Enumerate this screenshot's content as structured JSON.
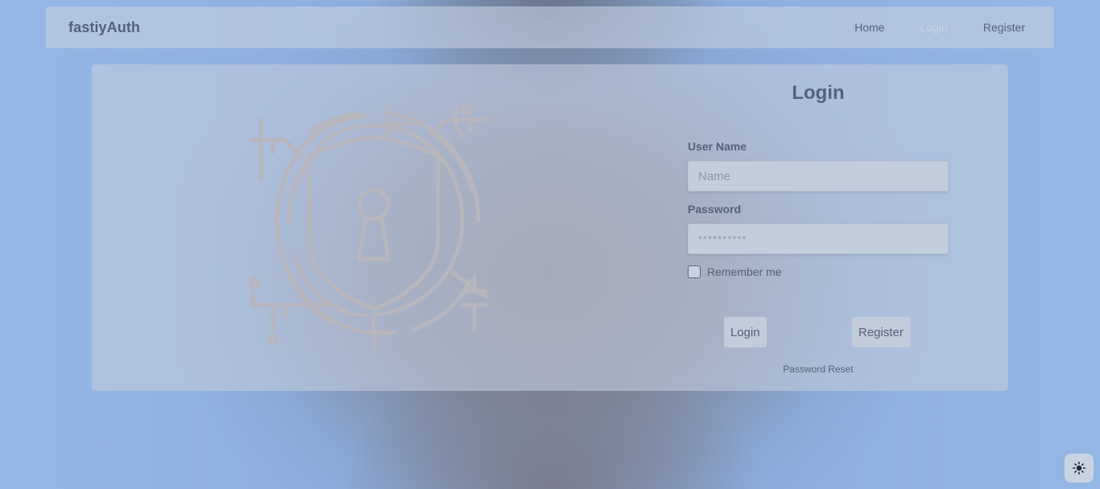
{
  "navbar": {
    "brand": "fastiyAuth",
    "links": [
      {
        "label": "Home"
      },
      {
        "label": "Login"
      },
      {
        "label": "Register"
      }
    ]
  },
  "login": {
    "title": "Login",
    "username": {
      "label": "User Name",
      "placeholder": "Name",
      "value": ""
    },
    "password": {
      "label": "Password",
      "placeholder": "**********",
      "value": ""
    },
    "remember_label": "Remember me",
    "remember_checked": false,
    "login_button": "Login",
    "register_button": "Register",
    "password_reset": "Password Reset"
  },
  "illustration": {
    "icon": "security-shield-lock-icon"
  },
  "theme_toggle": {
    "icon": "sun-icon"
  },
  "colors": {
    "text": "#55627a",
    "active_link": "#c9d2df",
    "card": "#c0cadc",
    "page_edge": "#95b7e6"
  }
}
